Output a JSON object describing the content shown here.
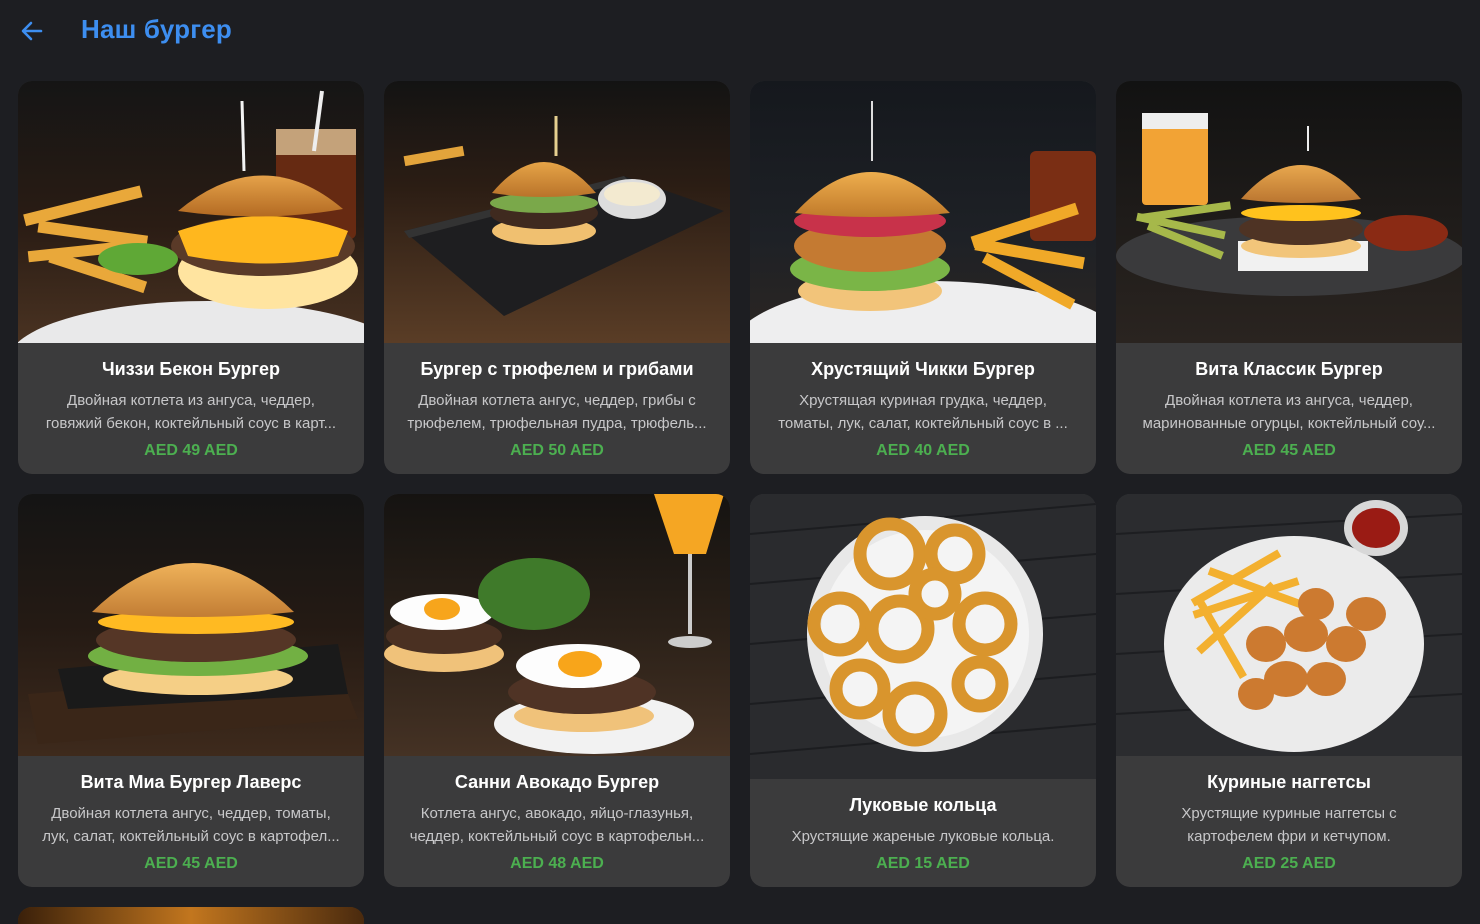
{
  "header": {
    "title": "Наш бургер",
    "back_icon": "arrow-left-icon",
    "accent": "#3d8ef0"
  },
  "colors": {
    "background": "#1d1e22",
    "card": "#3b3b3c",
    "price": "#4caf50"
  },
  "items": [
    {
      "name": "Чиззи Бекон Бургер",
      "desc1": "Двойная котлета из ангуса, чеддер,",
      "desc2": "говяжий бекон, коктейльный соус в карт...",
      "price": "AED 49 AED",
      "image": "burger-fries-photo"
    },
    {
      "name": "Бургер с трюфелем и грибами",
      "desc1": "Двойная котлета ангус, чеддер, грибы с",
      "desc2": "трюфелем, трюфельная пудра, трюфель...",
      "price": "AED 50 AED",
      "image": "burger-tray-photo"
    },
    {
      "name": "Хрустящий Чикки Бургер",
      "desc1": "Хрустящая куриная грудка, чеддер,",
      "desc2": "томаты, лук, салат, коктейльный соус в ...",
      "price": "AED 40 AED",
      "image": "chicken-burger-photo"
    },
    {
      "name": "Вита Классик Бургер",
      "desc1": "Двойная котлета из ангуса, чеддер,",
      "desc2": "маринованные огурцы, коктейльный соу...",
      "price": "AED 45 AED",
      "image": "classic-burger-photo"
    },
    {
      "name": "Вита Миа Бургер Лаверс",
      "desc1": "Двойная котлета ангус, чеддер, томаты,",
      "desc2": "лук, салат, коктейльный соус в картофел...",
      "price": "AED 45 AED",
      "image": "burger-board-photo"
    },
    {
      "name": "Санни Авокадо Бургер",
      "desc1": "Котлета ангус, авокадо, яйцо-глазунья,",
      "desc2": "чеддер, коктейльный соус в картофельн...",
      "price": "AED 48 AED",
      "image": "egg-burger-photo"
    },
    {
      "name": "Луковые кольца",
      "desc1": "Хрустящие жареные луковые кольца.",
      "desc2": "",
      "price": "AED 15 AED",
      "image": "onion-rings-photo"
    },
    {
      "name": "Куриные наггетсы",
      "desc1": "Хрустящие куриные наггетсы с",
      "desc2": "картофелем фри и кетчупом.",
      "price": "AED 25 AED",
      "image": "nuggets-photo"
    }
  ]
}
